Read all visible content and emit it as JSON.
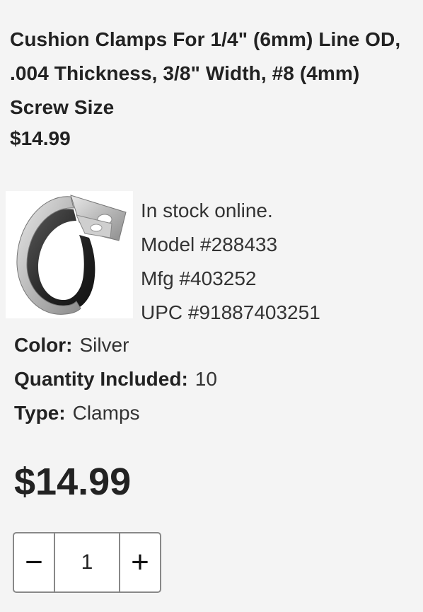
{
  "product": {
    "title": "Cushion Clamps For 1/4\" (6mm) Line OD, .004 Thickness, 3/8\" Width, #8 (4mm) Screw Size",
    "price": "$14.99",
    "image_icon": "cushion-clamp-image"
  },
  "availability": {
    "stock": "In stock online.",
    "model": "Model #288433",
    "mfg": "Mfg #403252",
    "upc": "UPC #91887403251"
  },
  "specs": [
    {
      "label": "Color:",
      "value": "Silver"
    },
    {
      "label": "Quantity Included:",
      "value": "10"
    },
    {
      "label": "Type:",
      "value": "Clamps"
    }
  ],
  "purchase": {
    "price": "$14.99",
    "quantity": {
      "minus_label": "−",
      "value": "1",
      "plus_label": "+"
    }
  }
}
